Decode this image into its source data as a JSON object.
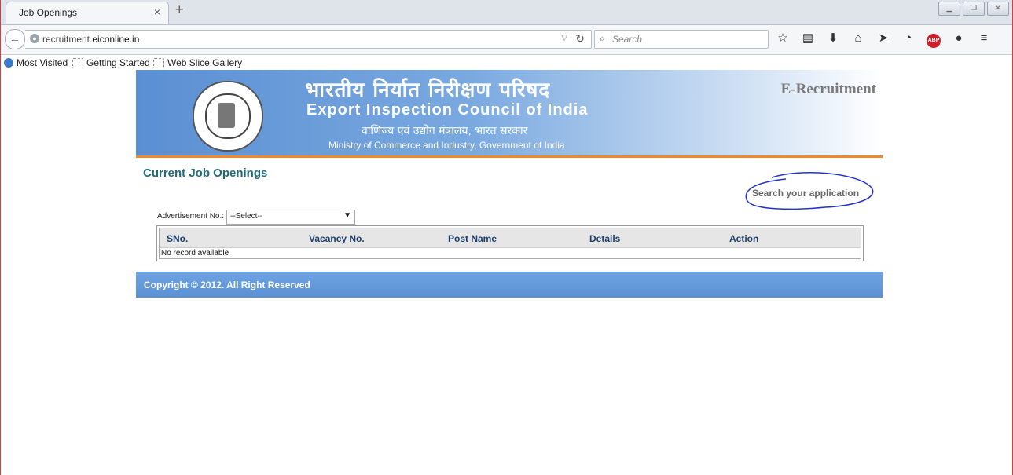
{
  "browser": {
    "tab_title": "Job Openings",
    "tab_close": "×",
    "new_tab": "+",
    "url_prefix": "recruitment.",
    "url_domain": "eiconline.in",
    "search_placeholder": "Search",
    "bookmarks": [
      "Most Visited",
      "Getting Started",
      "Web Slice Gallery"
    ],
    "toolbar_icons": [
      "star-icon",
      "reading-list-icon",
      "download-icon",
      "home-icon",
      "send-icon",
      "pocket-icon",
      "adblock-icon",
      "chat-icon",
      "menu-icon"
    ],
    "adblock_text": "ABP"
  },
  "header": {
    "hindi_title": "भारतीय निर्यात निरीक्षण परिषद",
    "english_title": "Export  Inspection Council of India",
    "hindi_subtitle": "वाणिज्य एवं उद्योग मंत्रालय, भारत सरकार",
    "ministry": "Ministry of Commerce and Industry, Government of India",
    "portal_name": "E-Recruitment"
  },
  "main": {
    "page_title": "Current Job Openings",
    "search_link": "Search your application",
    "advertisement_label": "Advertisement No.:",
    "advertisement_selected": "--Select--",
    "table": {
      "columns": [
        "SNo.",
        "Vacancy No.",
        "Post Name",
        "Details",
        "Action"
      ],
      "empty_message": "No record available"
    }
  },
  "footer": {
    "copyright": "Copyright © 2012. All Right Reserved"
  },
  "colors": {
    "header_blue": "#5a8fd3",
    "accent_orange": "#f0892a",
    "title_teal": "#1e6b7b",
    "footer_blue": "#5b91d3"
  }
}
